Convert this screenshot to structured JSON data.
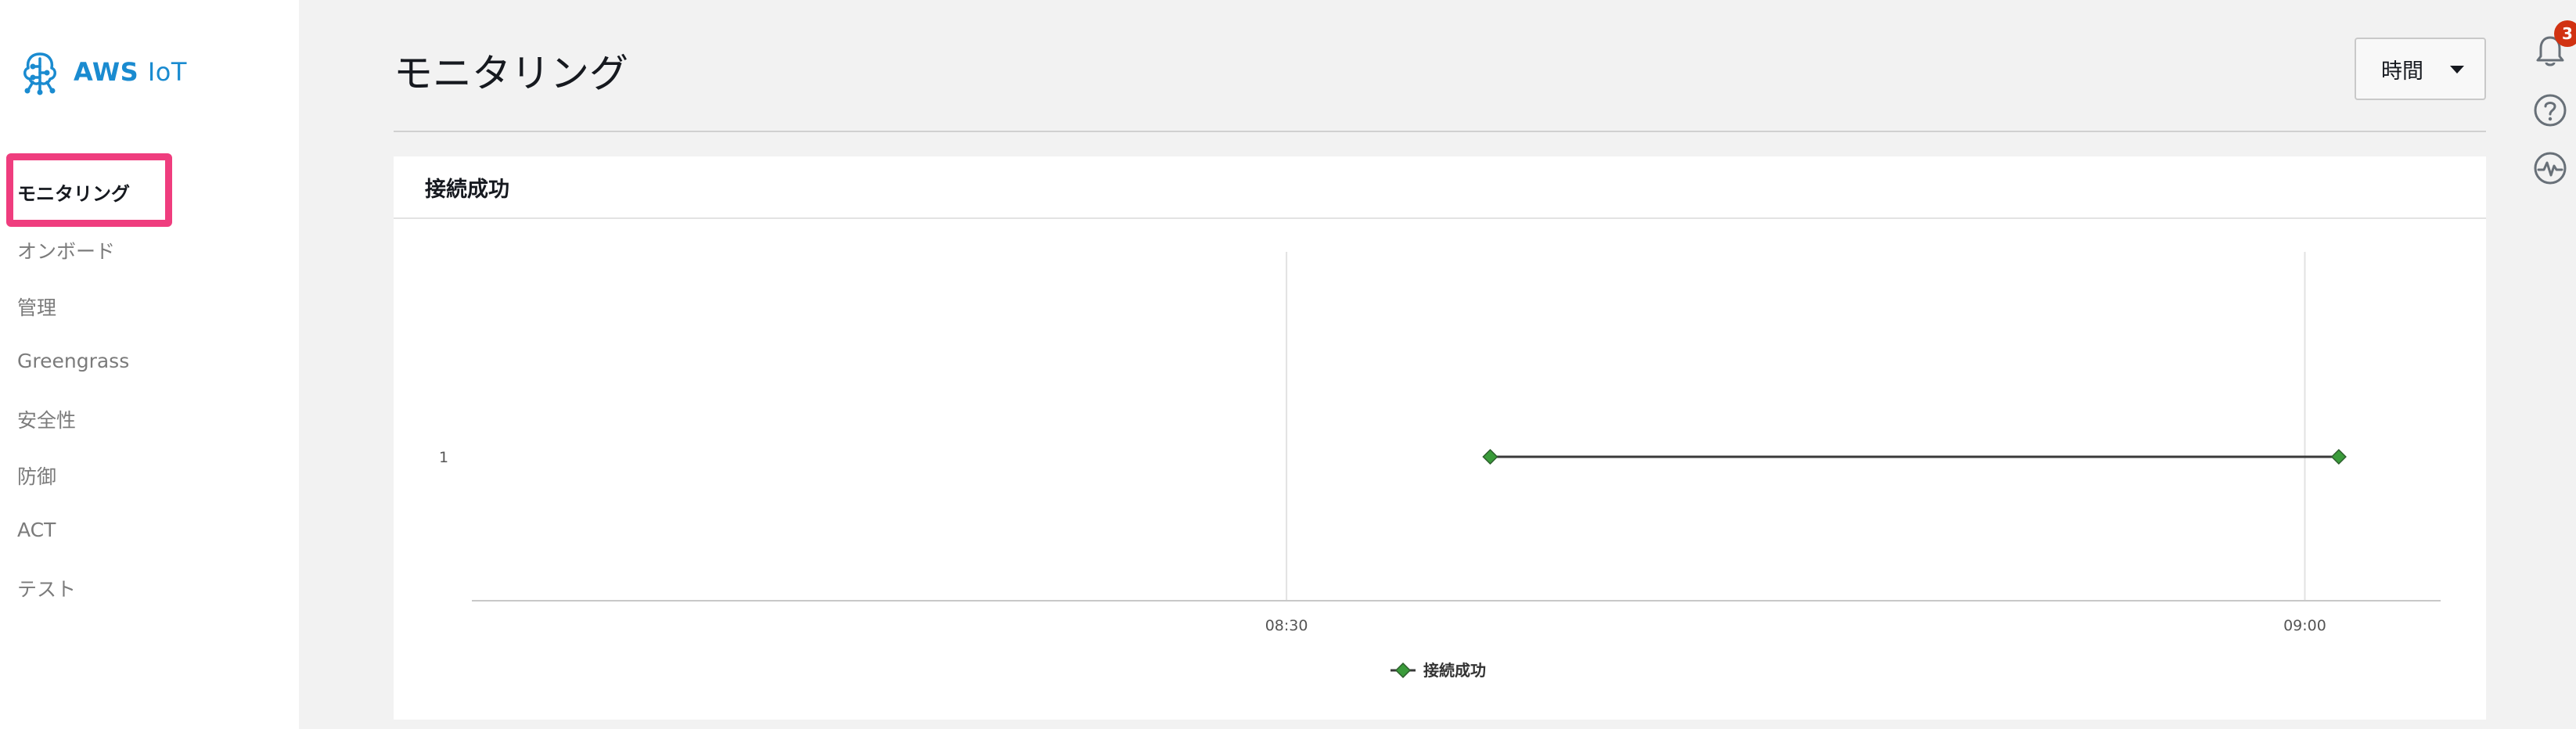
{
  "brand": {
    "name_bold": "AWS",
    "name_light": "IoT",
    "icon": "aws-iot-logo-icon",
    "color": "#1a8bd0"
  },
  "sidebar": {
    "items": [
      {
        "label": "モニタリング",
        "active": true
      },
      {
        "label": "オンボード",
        "active": false
      },
      {
        "label": "管理",
        "active": false
      },
      {
        "label": "Greengrass",
        "active": false
      },
      {
        "label": "安全性",
        "active": false
      },
      {
        "label": "防御",
        "active": false
      },
      {
        "label": "ACT",
        "active": false
      },
      {
        "label": "テスト",
        "active": false
      }
    ],
    "highlight_color": "#ef3d7e"
  },
  "header": {
    "title": "モニタリング",
    "time_dropdown": {
      "label": "時間",
      "icon": "caret-down-icon"
    }
  },
  "rail": {
    "notifications": {
      "icon": "bell-icon",
      "badge": "3"
    },
    "help": {
      "icon": "question-circle-icon"
    },
    "health": {
      "icon": "pulse-circle-icon"
    }
  },
  "card": {
    "title": "接続成功"
  },
  "chart_data": {
    "type": "line",
    "title": "",
    "x_ticks": [
      "08:30",
      "09:00"
    ],
    "y_ticks": [
      "1"
    ],
    "series": [
      {
        "name": "接続成功",
        "color": "#3a9b3a",
        "points": [
          {
            "x": "08:36",
            "y": 1
          },
          {
            "x": "09:01",
            "y": 1
          }
        ]
      }
    ],
    "legend_position": "bottom-center",
    "grid": "vertical"
  }
}
